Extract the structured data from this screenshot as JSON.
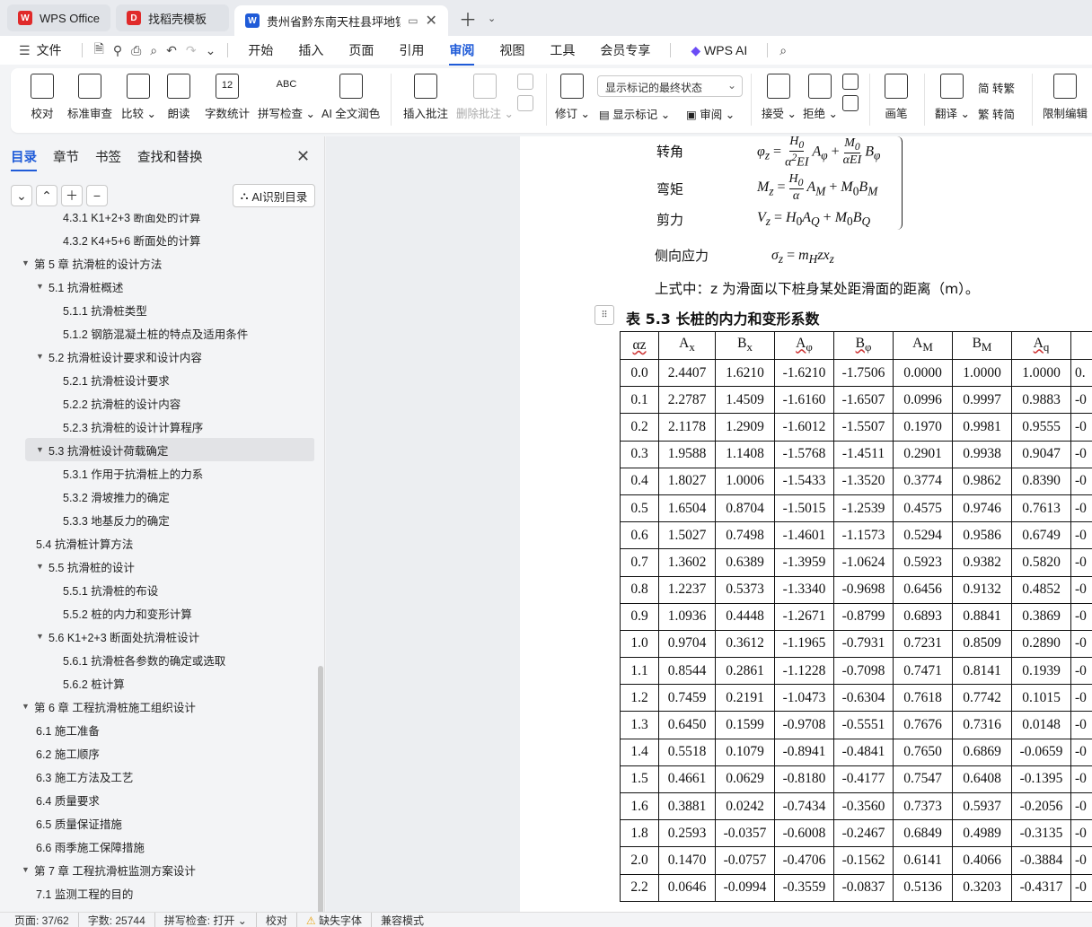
{
  "tabs": [
    {
      "label": "WPS Office",
      "icon": "wps-logo-icon",
      "color": "#e02a2a"
    },
    {
      "label": "找稻壳模板",
      "icon": "docer-icon",
      "color": "#e02a2a"
    },
    {
      "label": "贵州省黔东南天柱县坪地镇某",
      "icon": "writer-doc-icon",
      "color": "#1f5bd8"
    }
  ],
  "menu": {
    "file": "文件",
    "items": [
      "开始",
      "插入",
      "页面",
      "引用",
      "审阅",
      "视图",
      "工具",
      "会员专享"
    ],
    "active": "审阅",
    "wps_ai": "WPS AI"
  },
  "ribbon": {
    "proofread": "校对",
    "standard_review": "标准审查",
    "compare": "比较",
    "read_aloud": "朗读",
    "word_count": "字数统计",
    "spell_check": "拼写检查",
    "ai_polish": "AI 全文润色",
    "insert_comment": "插入批注",
    "delete_comment": "删除批注",
    "revise": "修订",
    "markup_select": "显示标记的最终状态",
    "show_markup": "显示标记",
    "review_pane": "审阅",
    "accept": "接受",
    "reject": "拒绝",
    "draw": "画笔",
    "translate": "翻译",
    "to_traditional": "转繁",
    "to_simplified": "转简",
    "restrict_edit": "限制编辑",
    "word_count_icon_text": "12",
    "spell_icon_text": "ABC"
  },
  "nav": {
    "tabs": [
      "目录",
      "章节",
      "书签",
      "查找和替换"
    ],
    "active": "目录",
    "ai_toc": "AI识别目录",
    "toc": [
      {
        "level": 3,
        "text": "4.3.1 K1+2+3 断面处的计算",
        "toggle": ""
      },
      {
        "level": 3,
        "text": "4.3.2 K4+5+6 断面处的计算",
        "toggle": ""
      },
      {
        "level": 1,
        "text": "第 5 章  抗滑桩的设计方法",
        "toggle": "▼"
      },
      {
        "level": 2,
        "text": "5.1  抗滑桩概述",
        "toggle": "▼"
      },
      {
        "level": 3,
        "text": "5.1.1  抗滑桩类型",
        "toggle": ""
      },
      {
        "level": 3,
        "text": "5.1.2  钢筋混凝土桩的特点及适用条件",
        "toggle": ""
      },
      {
        "level": 2,
        "text": "5.2  抗滑桩设计要求和设计内容",
        "toggle": "▼"
      },
      {
        "level": 3,
        "text": "5.2.1  抗滑桩设计要求",
        "toggle": ""
      },
      {
        "level": 3,
        "text": "5.2.2  抗滑桩的设计内容",
        "toggle": ""
      },
      {
        "level": 3,
        "text": "5.2.3  抗滑桩的设计计算程序",
        "toggle": ""
      },
      {
        "level": 2,
        "text": "5.3  抗滑桩设计荷载确定",
        "toggle": "▼",
        "highlight": true
      },
      {
        "level": 3,
        "text": "5.3.1  作用于抗滑桩上的力系",
        "toggle": ""
      },
      {
        "level": 3,
        "text": "5.3.2  滑坡推力的确定",
        "toggle": ""
      },
      {
        "level": 3,
        "text": "5.3.3  地基反力的确定",
        "toggle": ""
      },
      {
        "level": 2,
        "text": "5.4  抗滑桩计算方法",
        "toggle": ""
      },
      {
        "level": 2,
        "text": "5.5  抗滑桩的设计",
        "toggle": "▼"
      },
      {
        "level": 3,
        "text": "5.5.1  抗滑桩的布设",
        "toggle": ""
      },
      {
        "level": 3,
        "text": "5.5.2  桩的内力和变形计算",
        "toggle": ""
      },
      {
        "level": 2,
        "text": "5.6 K1+2+3 断面处抗滑桩设计",
        "toggle": "▼"
      },
      {
        "level": 3,
        "text": "5.6.1  抗滑桩各参数的确定或选取",
        "toggle": ""
      },
      {
        "level": 3,
        "text": "5.6.2  桩计算",
        "toggle": ""
      },
      {
        "level": 1,
        "text": "第 6 章  工程抗滑桩施工组织设计",
        "toggle": "▼"
      },
      {
        "level": 2,
        "text": "6.1  施工准备",
        "toggle": ""
      },
      {
        "level": 2,
        "text": "6.2  施工顺序",
        "toggle": ""
      },
      {
        "level": 2,
        "text": "6.3 施工方法及工艺",
        "toggle": ""
      },
      {
        "level": 2,
        "text": "6.4  质量要求",
        "toggle": ""
      },
      {
        "level": 2,
        "text": "6.5  质量保证措施",
        "toggle": ""
      },
      {
        "level": 2,
        "text": "6.6  雨季施工保障措施",
        "toggle": ""
      },
      {
        "level": 1,
        "text": "第 7 章  工程抗滑桩监测方案设计",
        "toggle": "▼"
      },
      {
        "level": 2,
        "text": "7.1  监测工程的目的",
        "toggle": ""
      }
    ]
  },
  "doc": {
    "formula_labels": {
      "rotation": "转角",
      "moment": "弯矩",
      "shear": "剪力",
      "lateral": "侧向应力"
    },
    "paragraph": "上式中：z 为滑面以下桩身某处距滑面的距离（m）。",
    "table_caption": "表 5.3  长桩的内力和变形系数",
    "table": {
      "headers": [
        "αz",
        "Ax",
        "Bx",
        "Aφ",
        "Bφ",
        "AM",
        "BM",
        "Aq"
      ],
      "rows": [
        [
          "0.0",
          "2.4407",
          "1.6210",
          "-1.6210",
          "-1.7506",
          "0.0000",
          "1.0000",
          "1.0000",
          "0."
        ],
        [
          "0.1",
          "2.2787",
          "1.4509",
          "-1.6160",
          "-1.6507",
          "0.0996",
          "0.9997",
          "0.9883",
          "-0"
        ],
        [
          "0.2",
          "2.1178",
          "1.2909",
          "-1.6012",
          "-1.5507",
          "0.1970",
          "0.9981",
          "0.9555",
          "-0"
        ],
        [
          "0.3",
          "1.9588",
          "1.1408",
          "-1.5768",
          "-1.4511",
          "0.2901",
          "0.9938",
          "0.9047",
          "-0"
        ],
        [
          "0.4",
          "1.8027",
          "1.0006",
          "-1.5433",
          "-1.3520",
          "0.3774",
          "0.9862",
          "0.8390",
          "-0"
        ],
        [
          "0.5",
          "1.6504",
          "0.8704",
          "-1.5015",
          "-1.2539",
          "0.4575",
          "0.9746",
          "0.7613",
          "-0"
        ],
        [
          "0.6",
          "1.5027",
          "0.7498",
          "-1.4601",
          "-1.1573",
          "0.5294",
          "0.9586",
          "0.6749",
          "-0"
        ],
        [
          "0.7",
          "1.3602",
          "0.6389",
          "-1.3959",
          "-1.0624",
          "0.5923",
          "0.9382",
          "0.5820",
          "-0"
        ],
        [
          "0.8",
          "1.2237",
          "0.5373",
          "-1.3340",
          "-0.9698",
          "0.6456",
          "0.9132",
          "0.4852",
          "-0"
        ],
        [
          "0.9",
          "1.0936",
          "0.4448",
          "-1.2671",
          "-0.8799",
          "0.6893",
          "0.8841",
          "0.3869",
          "-0"
        ],
        [
          "1.0",
          "0.9704",
          "0.3612",
          "-1.1965",
          "-0.7931",
          "0.7231",
          "0.8509",
          "0.2890",
          "-0"
        ],
        [
          "1.1",
          "0.8544",
          "0.2861",
          "-1.1228",
          "-0.7098",
          "0.7471",
          "0.8141",
          "0.1939",
          "-0"
        ],
        [
          "1.2",
          "0.7459",
          "0.2191",
          "-1.0473",
          "-0.6304",
          "0.7618",
          "0.7742",
          "0.1015",
          "-0"
        ],
        [
          "1.3",
          "0.6450",
          "0.1599",
          "-0.9708",
          "-0.5551",
          "0.7676",
          "0.7316",
          "0.0148",
          "-0"
        ],
        [
          "1.4",
          "0.5518",
          "0.1079",
          "-0.8941",
          "-0.4841",
          "0.7650",
          "0.6869",
          "-0.0659",
          "-0"
        ],
        [
          "1.5",
          "0.4661",
          "0.0629",
          "-0.8180",
          "-0.4177",
          "0.7547",
          "0.6408",
          "-0.1395",
          "-0"
        ],
        [
          "1.6",
          "0.3881",
          "0.0242",
          "-0.7434",
          "-0.3560",
          "0.7373",
          "0.5937",
          "-0.2056",
          "-0"
        ],
        [
          "1.8",
          "0.2593",
          "-0.0357",
          "-0.6008",
          "-0.2467",
          "0.6849",
          "0.4989",
          "-0.3135",
          "-0"
        ],
        [
          "2.0",
          "0.1470",
          "-0.0757",
          "-0.4706",
          "-0.1562",
          "0.6141",
          "0.4066",
          "-0.3884",
          "-0"
        ],
        [
          "2.2",
          "0.0646",
          "-0.0994",
          "-0.3559",
          "-0.0837",
          "0.5136",
          "0.3203",
          "-0.4317",
          "-0"
        ]
      ]
    }
  },
  "status": {
    "page": "页面: 37/62",
    "words": "字数: 25744",
    "spell": "拼写检查: 打开",
    "proof": "校对",
    "missing_font": "缺失字体",
    "compat": "兼容模式"
  },
  "colors": {
    "accent": "#1f5bd8",
    "wps_red": "#e02a2a"
  }
}
